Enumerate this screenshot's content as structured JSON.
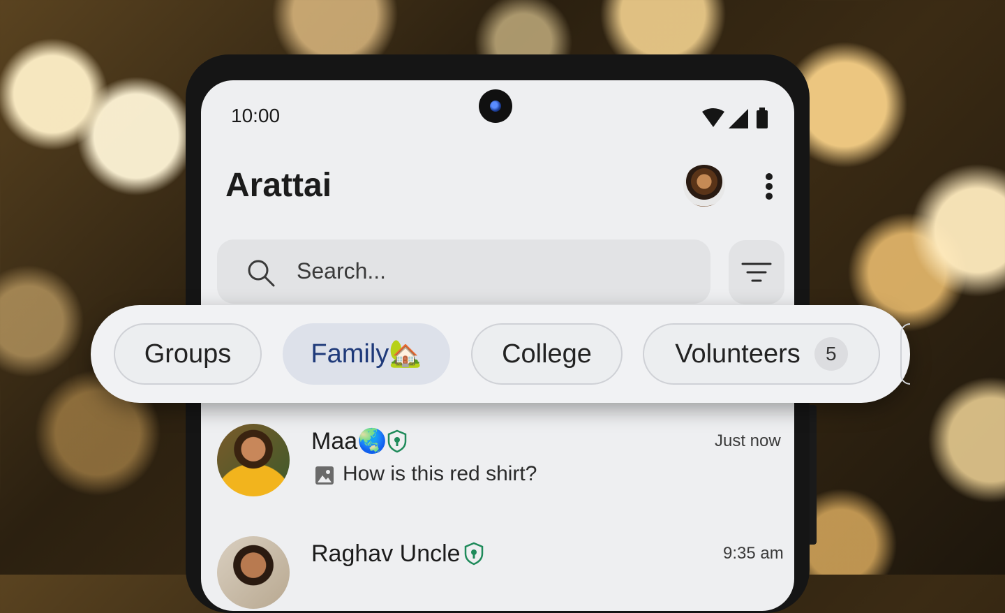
{
  "status_bar": {
    "time": "10:00",
    "icons": [
      "wifi-icon",
      "signal-icon",
      "battery-icon"
    ]
  },
  "header": {
    "title": "Arattai",
    "avatar": "profile-avatar",
    "menu_icon": "more-vert-icon"
  },
  "search": {
    "placeholder": "Search...",
    "filter_icon": "filter-icon"
  },
  "chips": [
    {
      "label": "Groups",
      "active": false
    },
    {
      "label": "Family🏡",
      "active": true
    },
    {
      "label": "College",
      "active": false
    },
    {
      "label": "Volunteers",
      "active": false,
      "badge": "5"
    }
  ],
  "chats": [
    {
      "name": "Maa🌏",
      "verified": true,
      "time": "Just now",
      "preview": "How is this red shirt?",
      "preview_icon": "image-icon"
    },
    {
      "name": "Raghav Uncle",
      "verified": true,
      "time": "9:35 am"
    }
  ],
  "colors": {
    "accent": "#1f3a7a",
    "screen_bg": "#eeeff1",
    "verified": "#1e8a5a"
  }
}
